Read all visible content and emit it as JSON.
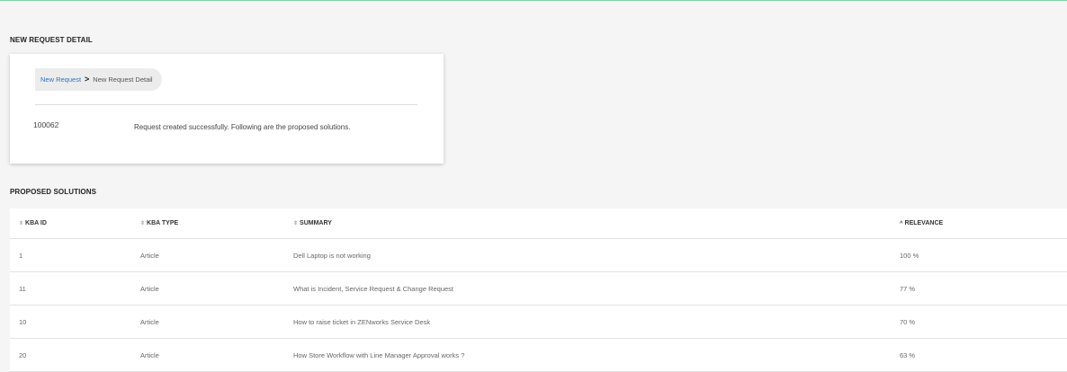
{
  "detail_section": {
    "title": "NEW REQUEST DETAIL",
    "breadcrumb": {
      "link": "New Request",
      "separator": ">",
      "current": "New Request Detail"
    },
    "request_id": "100062",
    "message": "Request created successfully. Following are the proposed solutions."
  },
  "solutions_section": {
    "title": "PROPOSED SOLUTIONS",
    "columns": {
      "kba_id": "KBA ID",
      "kba_type": "KBA TYPE",
      "summary": "SUMMARY",
      "relevance": "RELEVANCE"
    },
    "sort_icons": {
      "inactive": "⇕",
      "active": "^"
    },
    "rows": [
      {
        "id": "1",
        "type": "Article",
        "summary": "Dell Laptop is not working",
        "relevance": "100 %"
      },
      {
        "id": "11",
        "type": "Article",
        "summary": "What is Incident, Service Request & Change Request",
        "relevance": "77 %"
      },
      {
        "id": "10",
        "type": "Article",
        "summary": "How to raise ticket in ZENworks Service Desk",
        "relevance": "70 %"
      },
      {
        "id": "20",
        "type": "Article",
        "summary": "How Store Workflow with Line Manager Approval works ?",
        "relevance": "63 %"
      }
    ]
  },
  "colors": {
    "accent_line": "#7fd3a6",
    "link": "#2f74c0",
    "background": "#f5f5f5"
  }
}
